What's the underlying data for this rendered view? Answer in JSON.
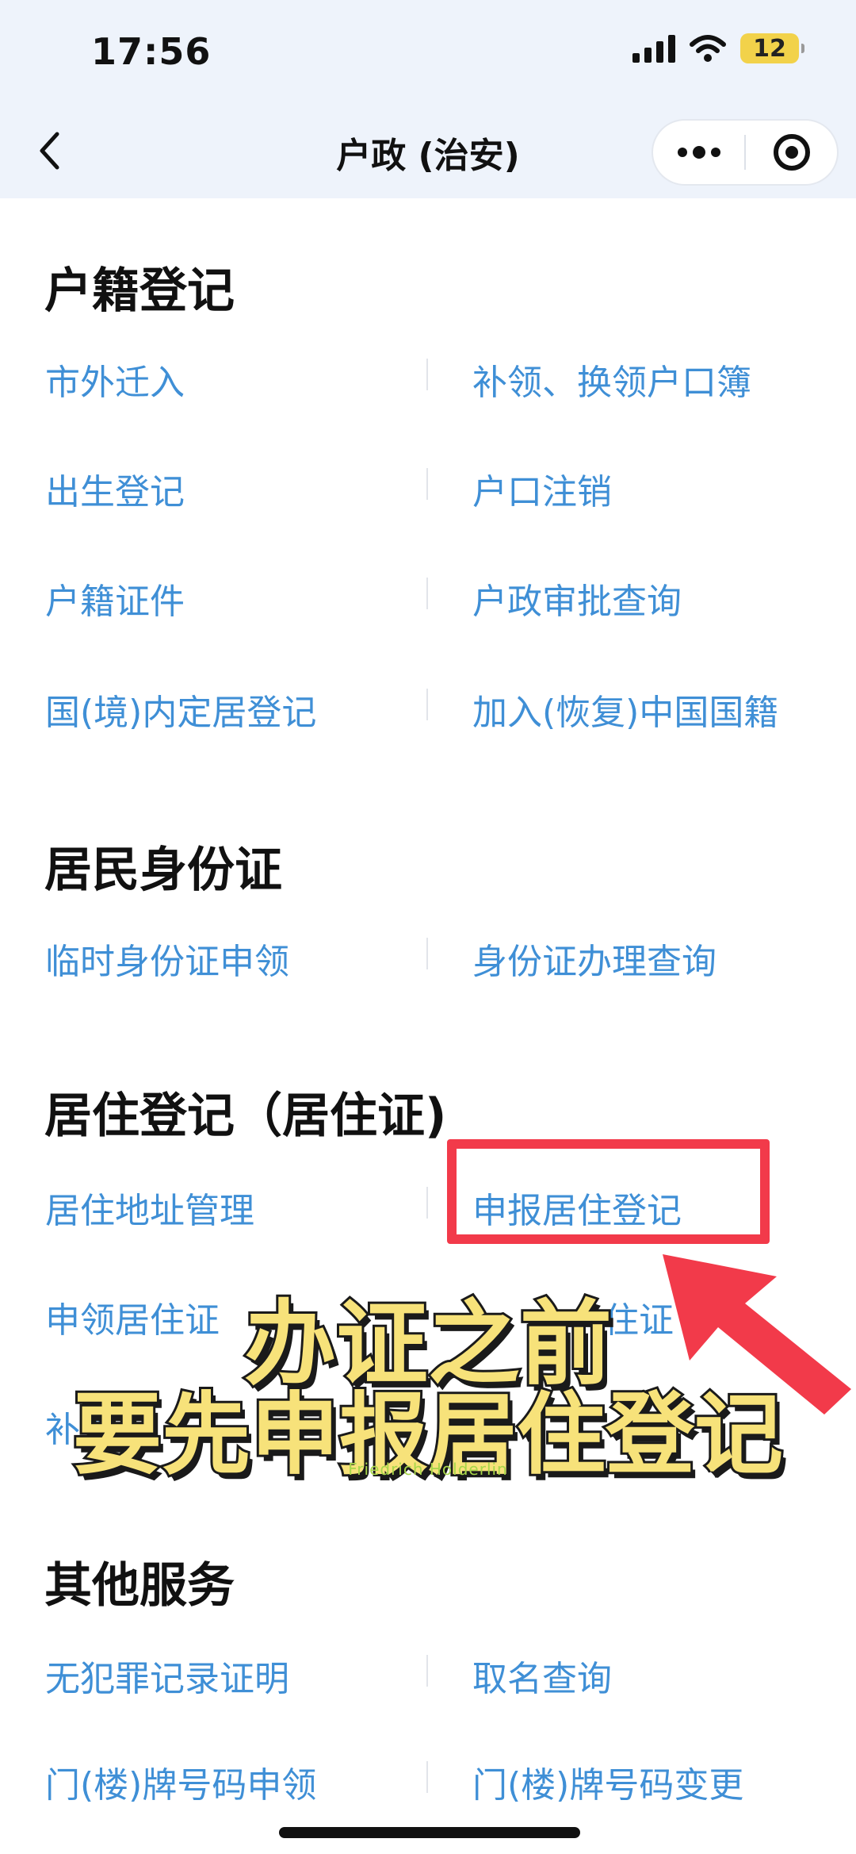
{
  "status_bar": {
    "time": "17:56",
    "battery_level": "12",
    "battery_color": "#f2d24a"
  },
  "nav": {
    "back_icon": "chevron-left-icon",
    "title": "户政 (治安)",
    "more_icon": "more-dots-icon",
    "close_icon": "target-circle-icon"
  },
  "sections": {
    "household": {
      "title": "户籍登记",
      "items": [
        "市外迁入",
        "补领、换领户口簿",
        "出生登记",
        "户口注销",
        "户籍证件",
        "户政审批查询",
        "国(境)内定居登记",
        "加入(恢复)中国国籍"
      ]
    },
    "id_card": {
      "title": "居民身份证",
      "items": [
        "临时身份证申领",
        "身份证办理查询"
      ]
    },
    "residence": {
      "title": "居住登记（居住证)",
      "items": [
        "居住地址管理",
        "申报居住登记",
        "申领居住证",
        "住证",
        "补领"
      ]
    },
    "other": {
      "title": "其他服务",
      "items": [
        "无犯罪记录证明",
        "取名查询",
        "门(楼)牌号码申领",
        "门(楼)牌号码变更"
      ]
    }
  },
  "overlay": {
    "caption_line1": "办证之前",
    "caption_line2": "要先申报居住登记",
    "watermark": "Friedrich Holderlin",
    "highlight_color": "#f23a4a",
    "arrow_color": "#f23a4a",
    "caption_color": "#f7e27a"
  },
  "colors": {
    "link": "#3f8fd6",
    "header_bg": "#eef3fb"
  }
}
